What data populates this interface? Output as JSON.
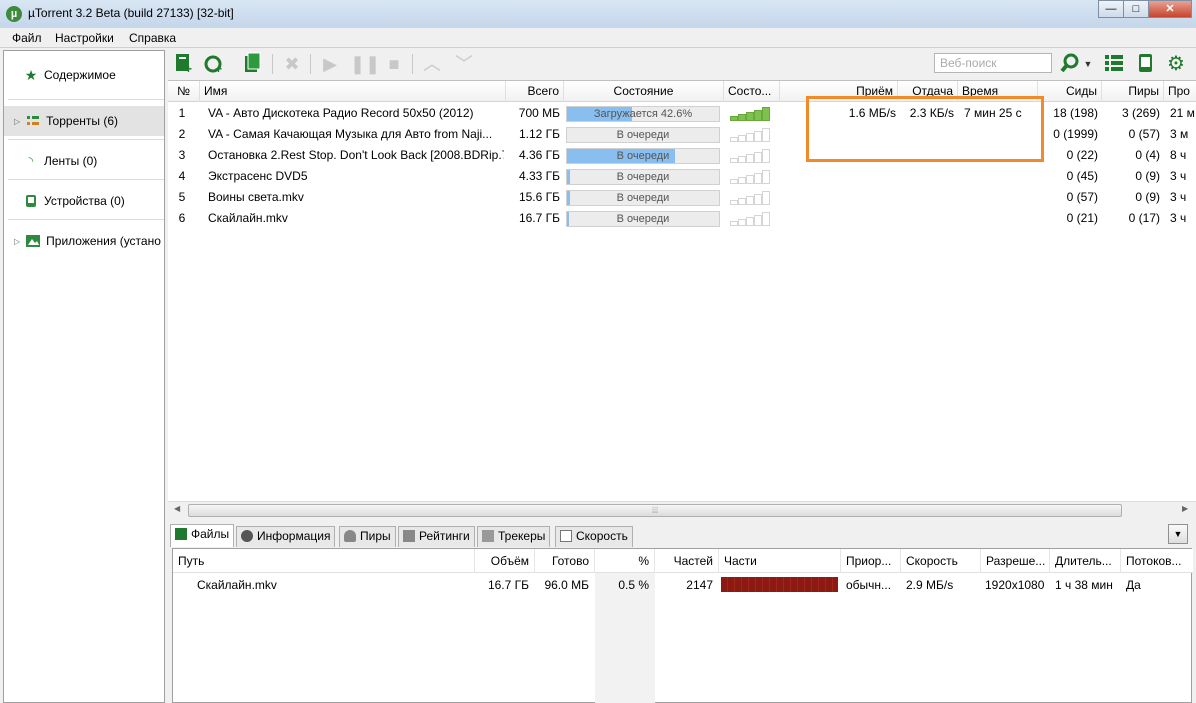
{
  "window": {
    "title": "µTorrent 3.2 Beta (build 27133) [32-bit]",
    "app_icon_glyph": "µ",
    "btn_minimize": "—",
    "btn_maximize": "□",
    "btn_close": "✕"
  },
  "menu": [
    "Файл",
    "Настройки",
    "Справка"
  ],
  "sidebar": {
    "items": [
      {
        "label": "Содержимое"
      },
      {
        "label": "Торренты (6)"
      },
      {
        "label": "Ленты (0)"
      },
      {
        "label": "Устройства (0)"
      },
      {
        "label": "Приложения (устано"
      }
    ]
  },
  "toolbar": {
    "search_placeholder": "Веб-поиск"
  },
  "torrents": {
    "columns": [
      "№",
      "Имя",
      "Всего",
      "Состояние",
      "Состо...",
      "Приём",
      "Отдача",
      "Время",
      "Сиды",
      "Пиры",
      "Про"
    ],
    "rows": [
      {
        "num": "1",
        "name": "VA - Авто Дискотека Радио Record 50x50 (2012)",
        "total": "700 МБ",
        "status": "Загружается 42.6%",
        "progress": 0.426,
        "health": 5,
        "down": "1.6 МБ/s",
        "up": "2.3 КБ/s",
        "eta": "7 мин 25 с",
        "seeds": "18 (198)",
        "peers": "3 (269)",
        "extra": "21 м"
      },
      {
        "num": "2",
        "name": "VA -  Самая Качающая Музыка для Авто from Naji...",
        "total": "1.12 ГБ",
        "status": "В очереди",
        "progress": 0.0,
        "health": 0,
        "down": "",
        "up": "",
        "eta": "",
        "seeds": "0 (1999)",
        "peers": "0 (57)",
        "extra": "3 м"
      },
      {
        "num": "3",
        "name": "Остановка 2.Rest Stop. Don't Look Back [2008.BDRip.7...",
        "total": "4.36 ГБ",
        "status": "В очереди",
        "progress": 0.71,
        "health": 0,
        "down": "",
        "up": "",
        "eta": "",
        "seeds": "0 (22)",
        "peers": "0 (4)",
        "extra": "8 ч"
      },
      {
        "num": "4",
        "name": "Экстрасенс DVD5",
        "total": "4.33 ГБ",
        "status": "В очереди",
        "progress": 0.02,
        "health": 0,
        "down": "",
        "up": "",
        "eta": "",
        "seeds": "0 (45)",
        "peers": "0 (9)",
        "extra": "3 ч"
      },
      {
        "num": "5",
        "name": "Воины света.mkv",
        "total": "15.6 ГБ",
        "status": "В очереди",
        "progress": 0.02,
        "health": 0,
        "down": "",
        "up": "",
        "eta": "",
        "seeds": "0 (57)",
        "peers": "0 (9)",
        "extra": "3 ч"
      },
      {
        "num": "6",
        "name": "Скайлайн.mkv",
        "total": "16.7 ГБ",
        "status": "В очереди",
        "progress": 0.01,
        "health": 0,
        "down": "",
        "up": "",
        "eta": "",
        "seeds": "0 (21)",
        "peers": "0 (17)",
        "extra": "3 ч"
      }
    ]
  },
  "detail_tabs": [
    "Файлы",
    "Информация",
    "Пиры",
    "Рейтинги",
    "Трекеры",
    "Скорость"
  ],
  "files": {
    "columns": [
      "Путь",
      "Объём",
      "Готово",
      "%",
      "Частей",
      "Части",
      "Приор...",
      "Скорость",
      "Разреше...",
      "Длитель...",
      "Потоков..."
    ],
    "rows": [
      {
        "path": "Скайлайн.mkv",
        "size": "16.7 ГБ",
        "done": "96.0 МБ",
        "pct": "0.5 %",
        "pieces": "2147",
        "priority": "обычн...",
        "speed": "2.9 МБ/s",
        "resolution": "1920x1080",
        "duration": "1 ч 38 мин",
        "streamable": "Да"
      }
    ]
  },
  "colors": {
    "highlight": "#f08a2a",
    "progress": "#88bff0",
    "health": "#7ec24e",
    "pieces": "#8b1a12"
  }
}
